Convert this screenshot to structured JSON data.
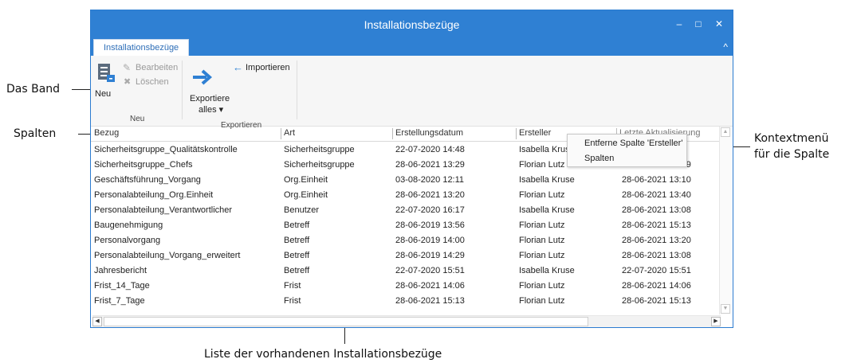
{
  "annotations": {
    "ribbon": "Das Band",
    "columns": "Spalten",
    "context_menu_line1": "Kontextmenü",
    "context_menu_line2": "für die Spalte",
    "list": "Liste  der vorhandenen Installationsbezüge"
  },
  "window": {
    "title": "Installationsbezüge",
    "minimize_glyph": "–",
    "maximize_glyph": "□",
    "close_glyph": "✕"
  },
  "ribbon": {
    "tab": "Installationsbezüge",
    "collapse_glyph": "^",
    "new_label": "Neu",
    "edit_label": "Bearbeiten",
    "delete_label": "Löschen",
    "group_new": "Neu",
    "export_all_line1": "Exportiere",
    "export_all_line2": "alles ▾",
    "import_label": "Importieren",
    "group_export": "Exportieren"
  },
  "table": {
    "headers": [
      "Bezug",
      "Art",
      "Erstellungsdatum",
      "Ersteller",
      "Letzte Aktualisierung"
    ],
    "rows": [
      [
        "Sicherheitsgruppe_Qualitätskontrolle",
        "Sicherheitsgruppe",
        "22-07-2020 14:48",
        "Isabella Krus",
        "..."
      ],
      [
        "Sicherheitsgruppe_Chefs",
        "Sicherheitsgruppe",
        "28-06-2021 13:29",
        "Florian Lutz",
        "28-06-2021 13:29"
      ],
      [
        "Geschäftsführung_Vorgang",
        "Org.Einheit",
        "03-08-2020 12:11",
        "Isabella Kruse",
        "28-06-2021 13:10"
      ],
      [
        "Personalabteilung_Org.Einheit",
        "Org.Einheit",
        "28-06-2021 13:20",
        "Florian Lutz",
        "28-06-2021 13:40"
      ],
      [
        "Personalabteilung_Verantwortlicher",
        "Benutzer",
        "22-07-2020 16:17",
        "Isabella Kruse",
        "28-06-2021 13:08"
      ],
      [
        "Baugenehmigung",
        "Betreff",
        "28-06-2019 13:56",
        "Florian Lutz",
        "28-06-2021 15:13"
      ],
      [
        "Personalvorgang",
        "Betreff",
        "28-06-2019 14:00",
        "Florian Lutz",
        "28-06-2021 13:20"
      ],
      [
        "Personalabteilung_Vorgang_erweitert",
        "Betreff",
        "28-06-2019 14:29",
        "Florian Lutz",
        "28-06-2021 13:08"
      ],
      [
        "Jahresbericht",
        "Betreff",
        "22-07-2020 15:51",
        "Isabella Kruse",
        "22-07-2020 15:51"
      ],
      [
        "Frist_14_Tage",
        "Frist",
        "28-06-2021 14:06",
        "Florian Lutz",
        "28-06-2021 14:06"
      ],
      [
        "Frist_7_Tage",
        "Frist",
        "28-06-2021 15:13",
        "Florian Lutz",
        "28-06-2021 15:13"
      ]
    ]
  },
  "context_menu": {
    "remove_column": "Entferne Spalte 'Ersteller'",
    "columns": "Spalten"
  },
  "colors": {
    "titlebar": "#2f80d3",
    "accent": "#2f6fb8"
  }
}
